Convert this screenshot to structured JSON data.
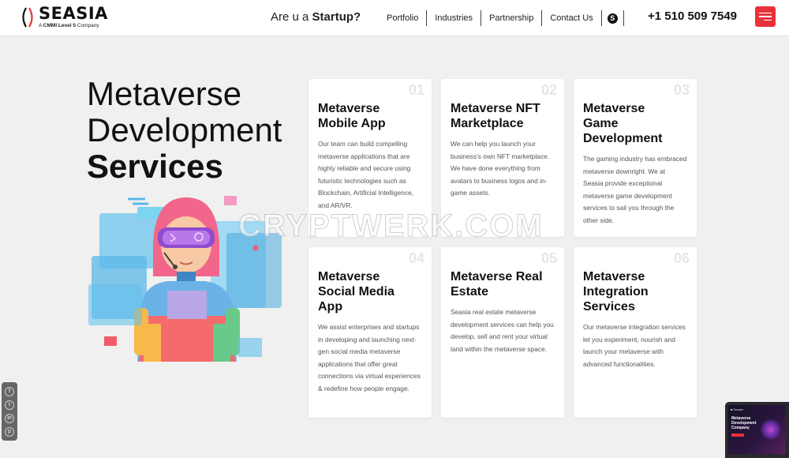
{
  "header": {
    "logo_name": "SEASIA",
    "logo_tag_prefix": "A",
    "logo_tag_bold": "CMMI Level 5",
    "logo_tag_suffix": "Company",
    "startup_prefix": "Are u a",
    "startup_bold": "Startup?",
    "nav": [
      "Portfolio",
      "Industries",
      "Partnership",
      "Contact Us"
    ],
    "phone": "+1 510 509 7549",
    "skype_glyph": "S"
  },
  "hero": {
    "line1": "Metaverse",
    "line2": "Development",
    "line3": "Services"
  },
  "cards": [
    {
      "num": "01",
      "title": "Metaverse Mobile App",
      "desc": "Our team can build compelling metaverse applications that are highly reliable and secure using futuristic technologies such as Blockchain, Artificial Intelligence, and AR/VR."
    },
    {
      "num": "02",
      "title": "Metaverse NFT Marketplace",
      "desc": "We can help you launch your business's own NFT marketplace. We have done everything from avatars to business logos and in-game assets."
    },
    {
      "num": "03",
      "title": "Metaverse Game Development",
      "desc": "The gaming industry has embraced metaverse downright. We at Seasia provide exceptional metaverse game development services to sail you through the other side."
    },
    {
      "num": "04",
      "title": "Metaverse Social Media App",
      "desc": "We assist enterprises and startups in developing and launching next-gen social media metaverse applications that offer great connections via virtual experiences & redefine how people engage."
    },
    {
      "num": "05",
      "title": "Metaverse Real Estate",
      "desc": "Seasia real estate metaverse development services can help you develop, sell and rent your virtual land within the metaverse space."
    },
    {
      "num": "06",
      "title": "Metaverse Integration Services",
      "desc": "Our metaverse integration services let you experiment, nourish and launch your metaverse with advanced functionalities."
    }
  ],
  "watermark": "CRYPTWERK.COM",
  "social": [
    "f",
    "t",
    "in",
    "p"
  ],
  "video_thumb": {
    "top": "■ Seasia",
    "title": "Metaverse Development Company"
  },
  "colors": {
    "accent": "#e8323a",
    "background": "#f0f0f0",
    "card": "#ffffff"
  }
}
